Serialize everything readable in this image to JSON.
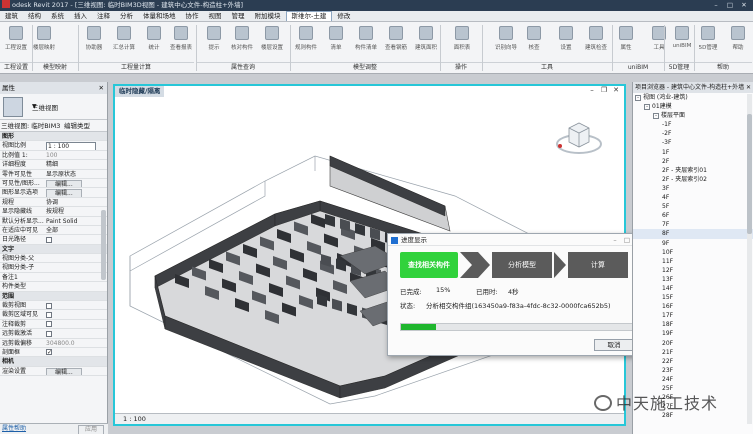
{
  "titlebar": {
    "title": "odesk Revit 2017 - [三维视图: 临时BIM3D视图 - 建筑中心文件-构造柱+外墙]"
  },
  "menu": [
    "建筑",
    "结构",
    "系统",
    "插入",
    "注释",
    "分析",
    "体量和场地",
    "协作",
    "视图",
    "管理",
    "附加模块",
    "斯维尔-土建",
    "修改"
  ],
  "menu_active_index": 11,
  "ribbon": {
    "buttons": [
      "工程设置",
      "楼层映射",
      "协助器",
      "汇总计算",
      "统计",
      "查看报表",
      "提示",
      "核对构件",
      "楼层设置",
      "规则构件",
      "清单",
      "构件清单",
      "查看钢筋",
      "建筑面积",
      "面积表",
      "识别向导",
      "核查",
      "设置",
      "建筑检查",
      "属性",
      "工具",
      "uniBIM",
      "5D管理",
      "帮助"
    ],
    "groups": [
      "工程设置",
      "模型映射",
      "工程量计算",
      "属性查询",
      "模型调整",
      "操作",
      "工具",
      "uniBIM",
      "5D管理",
      "帮助"
    ]
  },
  "properties": {
    "title": "属性",
    "type_name": "三维视图",
    "view_selector": "三维视图: 临时BIM3",
    "edit_type": "编辑类型",
    "rows": [
      {
        "k": "图形",
        "v": "",
        "type": "section"
      },
      {
        "k": "视图比例",
        "v": "1 : 100",
        "type": "input"
      },
      {
        "k": "比例值 1:",
        "v": "100",
        "type": "dim"
      },
      {
        "k": "详细程度",
        "v": "精细",
        "type": "text"
      },
      {
        "k": "零件可见性",
        "v": "显示原状态",
        "type": "text"
      },
      {
        "k": "可见性/图形...",
        "v": "编辑...",
        "type": "button"
      },
      {
        "k": "图形显示选项",
        "v": "编辑...",
        "type": "button"
      },
      {
        "k": "规程",
        "v": "协调",
        "type": "text"
      },
      {
        "k": "显示隐藏线",
        "v": "按规程",
        "type": "text"
      },
      {
        "k": "默认分析显示...",
        "v": "Paint Solid",
        "type": "text"
      },
      {
        "k": "在适应中可见",
        "v": "全部",
        "type": "text"
      },
      {
        "k": "日光路径",
        "v": "",
        "type": "check"
      },
      {
        "k": "文字",
        "v": "",
        "type": "section"
      },
      {
        "k": "视图分类-父",
        "v": "",
        "type": "text"
      },
      {
        "k": "视图分类-子",
        "v": "",
        "type": "text"
      },
      {
        "k": "备注1",
        "v": "",
        "type": "text"
      },
      {
        "k": "构件类型",
        "v": "",
        "type": "text"
      },
      {
        "k": "范围",
        "v": "",
        "type": "section"
      },
      {
        "k": "裁剪视图",
        "v": "",
        "type": "check"
      },
      {
        "k": "裁剪区域可见",
        "v": "",
        "type": "check"
      },
      {
        "k": "注释裁剪",
        "v": "",
        "type": "check"
      },
      {
        "k": "远剪裁激活",
        "v": "",
        "type": "check"
      },
      {
        "k": "远剪裁偏移",
        "v": "304800.0",
        "type": "dim"
      },
      {
        "k": "剖面框",
        "v": "",
        "type": "check_on"
      },
      {
        "k": "相机",
        "v": "",
        "type": "section"
      },
      {
        "k": "渲染设置",
        "v": "编辑...",
        "type": "button"
      }
    ],
    "help_link": "属性帮助",
    "apply": "应用"
  },
  "viewport": {
    "tab": "临时隐藏/隔离",
    "scale": "1 : 100"
  },
  "progress": {
    "title": "进度显示",
    "steps": [
      "查找相关构件",
      "分析模型",
      "计算"
    ],
    "done_label": "已完成:",
    "done_value": "15%",
    "time_label": "已用时:",
    "time_value": "4秒",
    "status_label": "状态:",
    "status_value": "分析相交构件组(163450a9-f83a-4fdc-8c32-0000fca652b5)",
    "fraction": 0.15,
    "cancel": "取消"
  },
  "browser": {
    "title": "项目浏览器 - 建筑中心文件-构造柱+外墙",
    "items": [
      {
        "label": "视图 (鸿业-建筑)",
        "indent": 0,
        "toggle": "-"
      },
      {
        "label": "01建模",
        "indent": 1,
        "toggle": "-"
      },
      {
        "label": "楼层平面",
        "indent": 2,
        "toggle": "-"
      },
      {
        "label": "-1F",
        "indent": 3
      },
      {
        "label": "-2F",
        "indent": 3
      },
      {
        "label": "-3F",
        "indent": 3
      },
      {
        "label": "1F",
        "indent": 3
      },
      {
        "label": "2F",
        "indent": 3
      },
      {
        "label": "2F - 夹层索引01",
        "indent": 3
      },
      {
        "label": "2F - 夹层索引02",
        "indent": 3
      },
      {
        "label": "3F",
        "indent": 3
      },
      {
        "label": "4F",
        "indent": 3
      },
      {
        "label": "5F",
        "indent": 3
      },
      {
        "label": "6F",
        "indent": 3
      },
      {
        "label": "7F",
        "indent": 3
      },
      {
        "label": "8F",
        "indent": 3,
        "selected": true
      },
      {
        "label": "9F",
        "indent": 3
      },
      {
        "label": "10F",
        "indent": 3
      },
      {
        "label": "11F",
        "indent": 3
      },
      {
        "label": "12F",
        "indent": 3
      },
      {
        "label": "13F",
        "indent": 3
      },
      {
        "label": "14F",
        "indent": 3
      },
      {
        "label": "15F",
        "indent": 3
      },
      {
        "label": "16F",
        "indent": 3
      },
      {
        "label": "17F",
        "indent": 3
      },
      {
        "label": "18F",
        "indent": 3
      },
      {
        "label": "19F",
        "indent": 3
      },
      {
        "label": "20F",
        "indent": 3
      },
      {
        "label": "21F",
        "indent": 3
      },
      {
        "label": "22F",
        "indent": 3
      },
      {
        "label": "23F",
        "indent": 3
      },
      {
        "label": "24F",
        "indent": 3
      },
      {
        "label": "25F",
        "indent": 3
      },
      {
        "label": "26F",
        "indent": 3
      },
      {
        "label": "27F",
        "indent": 3
      },
      {
        "label": "28F",
        "indent": 3
      }
    ]
  },
  "watermark": "中天施工技术",
  "colors": {
    "accent": "#27c7d8",
    "step_active": "#31d23c",
    "step_idle": "#5b5b5b",
    "progress_fill": "#1fb62d"
  }
}
